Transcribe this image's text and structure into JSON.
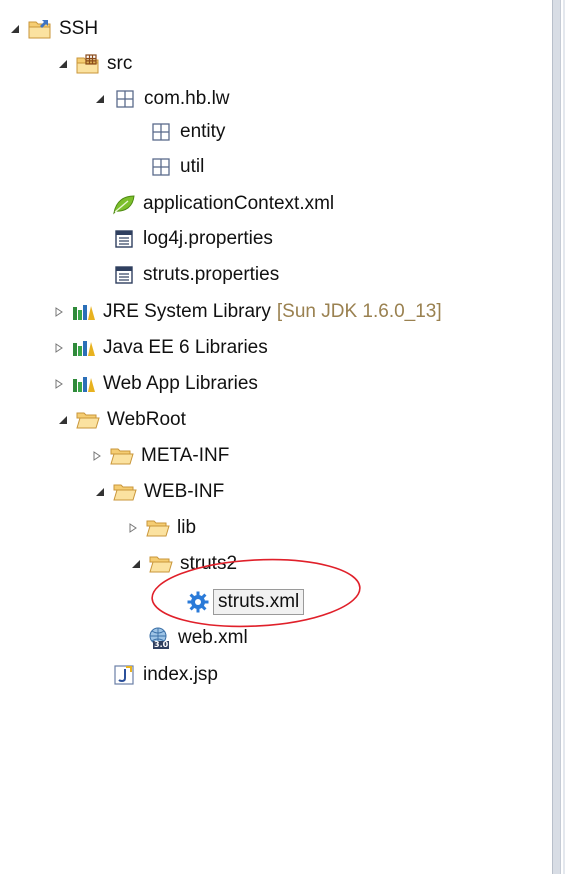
{
  "tree": {
    "project": {
      "label": "SSH"
    },
    "src": {
      "label": "src"
    },
    "package_root": {
      "label": "com.hb.lw"
    },
    "package_entity": {
      "label": "entity"
    },
    "package_util": {
      "label": "util"
    },
    "application_context": {
      "label": "applicationContext.xml"
    },
    "log4j": {
      "label": "log4j.properties"
    },
    "struts_properties": {
      "label": "struts.properties"
    },
    "jre_library": {
      "label": "JRE System Library",
      "decoration": "[Sun JDK 1.6.0_13]"
    },
    "javaee_library": {
      "label": "Java EE 6 Libraries"
    },
    "webapp_library": {
      "label": "Web App Libraries"
    },
    "webroot": {
      "label": "WebRoot"
    },
    "meta_inf": {
      "label": "META-INF"
    },
    "web_inf": {
      "label": "WEB-INF"
    },
    "lib": {
      "label": "lib"
    },
    "struts2": {
      "label": "struts2"
    },
    "struts_xml": {
      "label": "struts.xml"
    },
    "web_xml": {
      "label": "web.xml",
      "badge": "3.0"
    },
    "index_jsp": {
      "label": "index.jsp"
    }
  },
  "colors": {
    "folder": "#f5cd73",
    "package": "#5b6b8c",
    "library": "#2f8a3a",
    "leaf": "#7cbf2b",
    "gear": "#2a7ad8",
    "highlight": "#e0202a",
    "decoration": "#9a8150"
  }
}
